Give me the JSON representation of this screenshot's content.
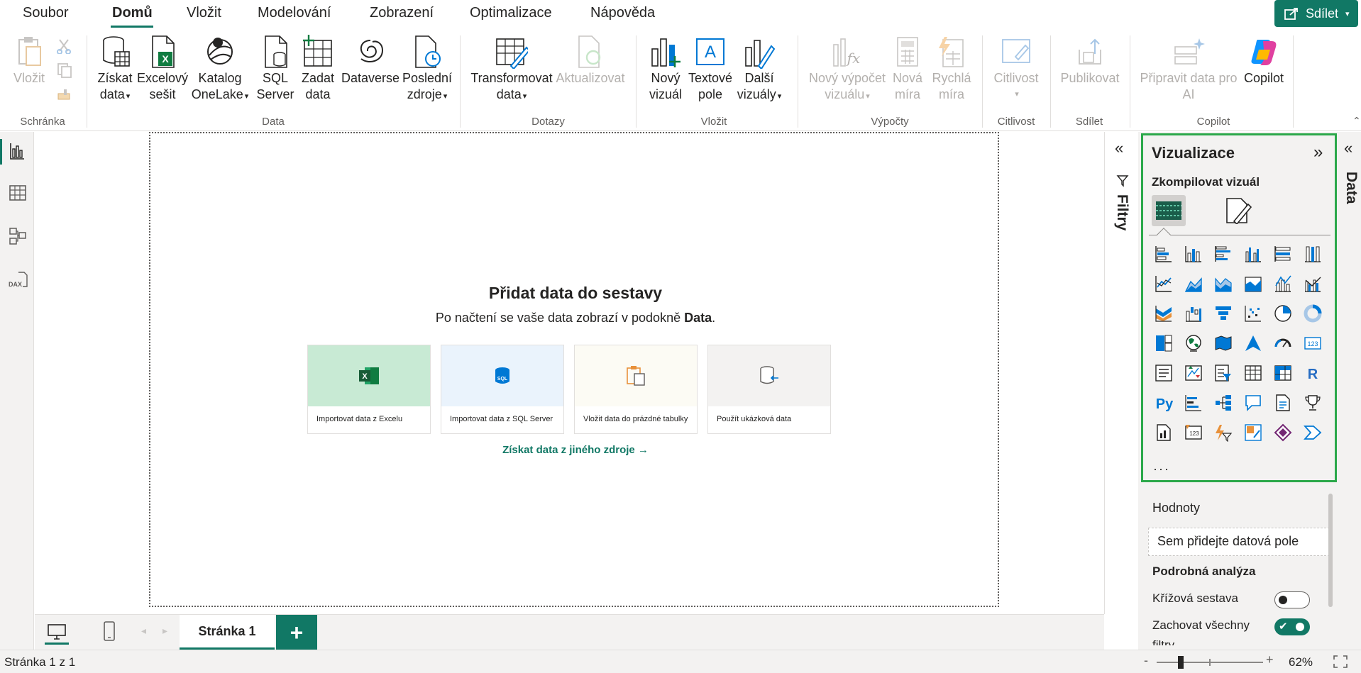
{
  "menu": {
    "tabs": [
      "Soubor",
      "Domů",
      "Vložit",
      "Modelování",
      "Zobrazení",
      "Optimalizace",
      "Nápověda"
    ],
    "active": "Domů",
    "share_label": "Sdílet"
  },
  "ribbon": {
    "paste": "Vložit",
    "get_data": [
      "Získat",
      "data"
    ],
    "excel": [
      "Excelový",
      "sešit"
    ],
    "onelake": [
      "Katalog",
      "OneLake"
    ],
    "sql": [
      "SQL",
      "Server"
    ],
    "enter_data": [
      "Zadat",
      "data"
    ],
    "dataverse": "Dataverse",
    "recent": [
      "Poslední",
      "zdroje"
    ],
    "transform": [
      "Transformovat",
      "data"
    ],
    "refresh": "Aktualizovat",
    "new_visual": [
      "Nový",
      "vizuál"
    ],
    "text_box": [
      "Textové",
      "pole"
    ],
    "more_visuals": [
      "Další",
      "vizuály"
    ],
    "new_calc": [
      "Nový výpočet",
      "vizuálu"
    ],
    "new_measure": [
      "Nová",
      "míra"
    ],
    "quick_measure": [
      "Rychlá",
      "míra"
    ],
    "sensitivity": "Citlivost",
    "publish": "Publikovat",
    "prep_ai": [
      "Připravit data pro",
      "AI"
    ],
    "copilot": "Copilot",
    "groups": {
      "clipboard": "Schránka",
      "data": "Data",
      "queries": "Dotazy",
      "insert": "Vložit",
      "calculations": "Výpočty",
      "sensitivity": "Citlivost",
      "share": "Sdílet",
      "copilot": "Copilot"
    }
  },
  "canvas": {
    "title": "Přidat data do sestavy",
    "desc_prefix": "Po načtení se vaše data zobrazí v podokně ",
    "desc_bold": "Data",
    "desc_suffix": ".",
    "cards": [
      {
        "label": "Importovat data z Excelu",
        "color": "#c8ead4",
        "icon": "excel-icon"
      },
      {
        "label": "Importovat data z SQL Server",
        "color": "#eaf3fc",
        "icon": "sql-icon"
      },
      {
        "label": "Vložit data do prázdné tabulky",
        "color": "#fcfbf4",
        "icon": "clipboard-icon"
      },
      {
        "label": "Použít ukázková data",
        "color": "#f3f2f1",
        "icon": "sample-data-icon"
      }
    ],
    "other_source": "Získat data z jiného zdroje →"
  },
  "filters_label": "Filtry",
  "data_label": "Data",
  "viz": {
    "title": "Vizualizace",
    "build_label": "Zkompilovat vizuál",
    "more": "···",
    "values_label": "Hodnoty",
    "values_placeholder": "Sem přidejte datová pole",
    "drill_label": "Podrobná analýza",
    "cross_report": "Křížová sestava",
    "keep_filters": "Zachovat všechny",
    "keep_filters_cut": "filtry"
  },
  "pages": {
    "current": "Stránka 1"
  },
  "status": {
    "page_info": "Stránka 1 z 1",
    "zoom": "62%"
  },
  "colors": {
    "accent": "#117865",
    "highlight": "#2ba84a"
  }
}
